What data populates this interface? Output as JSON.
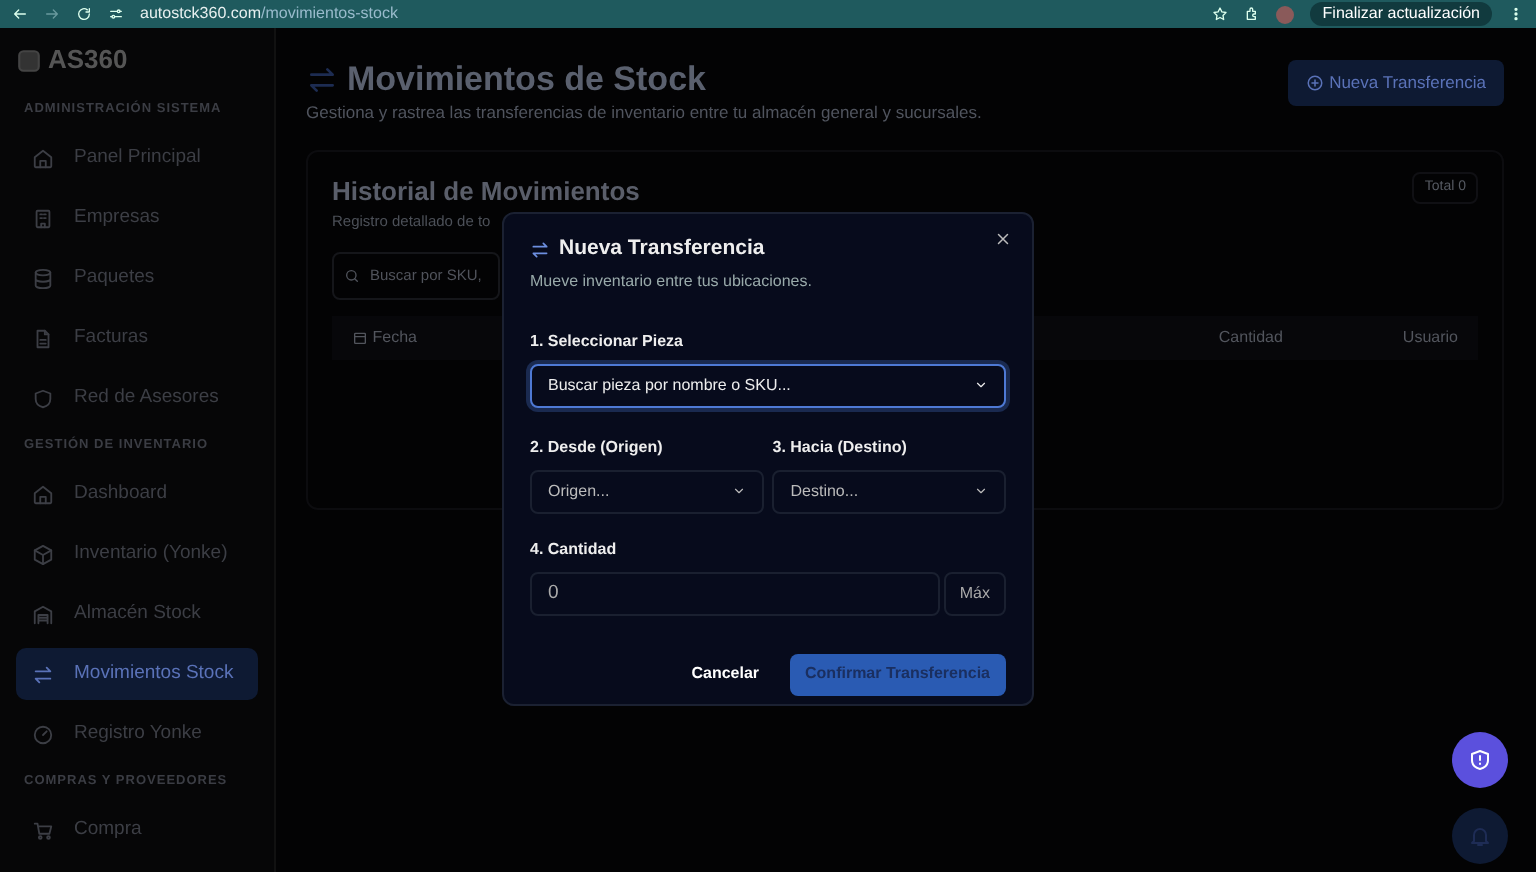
{
  "browser": {
    "url_host": "autostck360.com",
    "url_path": "/movimientos-stock",
    "update_button": "Finalizar actualización"
  },
  "sidebar": {
    "logo": "AS360",
    "sections": [
      {
        "title": "ADMINISTRACIÓN SISTEMA",
        "items": [
          {
            "label": "Panel Principal",
            "selected": false
          },
          {
            "label": "Empresas",
            "selected": false
          },
          {
            "label": "Paquetes",
            "selected": false
          },
          {
            "label": "Facturas",
            "selected": false
          },
          {
            "label": "Red de Asesores",
            "selected": false
          }
        ]
      },
      {
        "title": "GESTIÓN DE INVENTARIO",
        "items": [
          {
            "label": "Dashboard",
            "selected": false
          },
          {
            "label": "Inventario (Yonke)",
            "selected": false
          },
          {
            "label": "Almacén Stock",
            "selected": false
          },
          {
            "label": "Movimientos Stock",
            "selected": true
          },
          {
            "label": "Registro Yonke",
            "selected": false
          }
        ]
      },
      {
        "title": "COMPRAS Y PROVEEDORES",
        "items": [
          {
            "label": "Compra",
            "selected": false
          }
        ]
      }
    ]
  },
  "page": {
    "title": "Movimientos de Stock",
    "subtitle": "Gestiona y rastrea las transferencias de inventario entre tu almacén general y sucursales.",
    "new_button": "Nueva Transferencia"
  },
  "history": {
    "title": "Historial de Movimientos",
    "subtitle": "Registro detallado de to",
    "total": "Total 0",
    "search": {
      "placeholder": "Buscar por SKU,"
    },
    "columns": [
      "Fecha",
      "Cantidad",
      "Usuario"
    ]
  },
  "modal": {
    "title": "Nueva Transferencia",
    "subtitle": "Mueve inventario entre tus ubicaciones.",
    "part": {
      "label": "1. Seleccionar Pieza",
      "placeholder": "Buscar pieza por nombre o SKU..."
    },
    "from": {
      "label": "2. Desde (Origen)",
      "placeholder": "Origen..."
    },
    "to": {
      "label": "3. Hacia (Destino)",
      "placeholder": "Destino..."
    },
    "quantity": {
      "label": "4. Cantidad",
      "value": "0",
      "max_button": "Máx"
    },
    "cancel": "Cancelar",
    "confirm": "Confirmar Transferencia"
  }
}
